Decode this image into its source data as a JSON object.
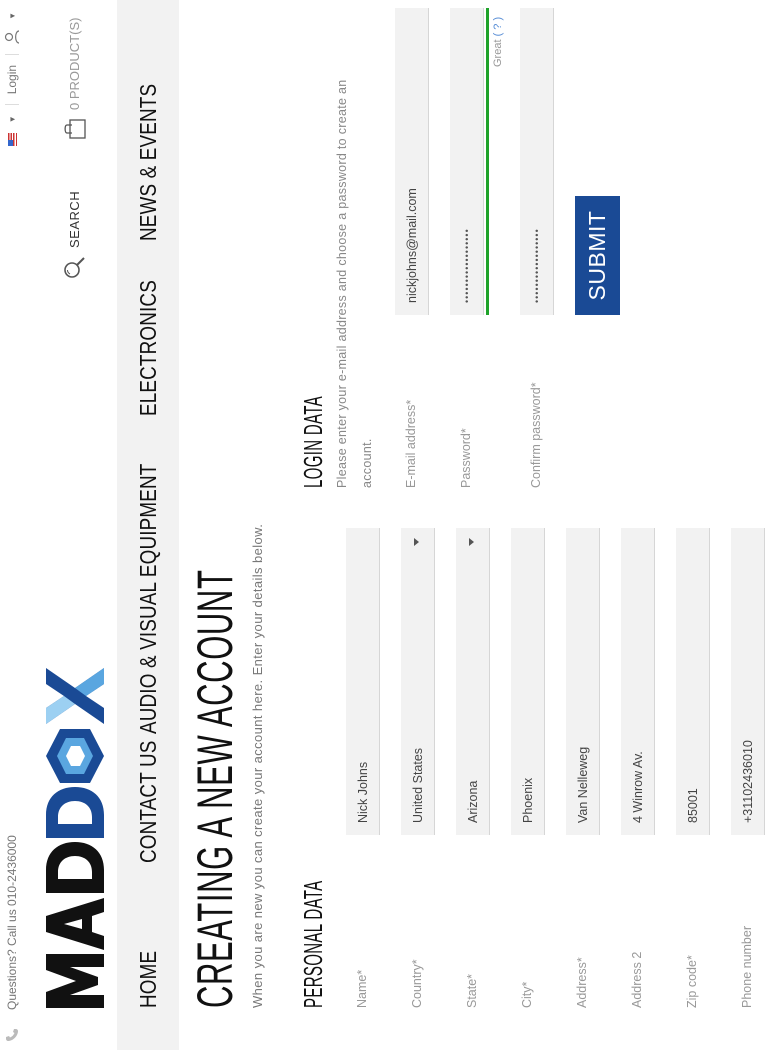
{
  "topbar": {
    "phone_text": "Questions? Call us 010-2436000",
    "login_label": "Login",
    "flag_icon": "us-flag-icon",
    "user_icon": "user-icon"
  },
  "header": {
    "logo_text": "MADDOX",
    "search_label": "SEARCH",
    "cart_label": "0 PRODUCT(S)"
  },
  "nav": {
    "items": [
      "HOME",
      "CONTACT US",
      "AUDIO & VISUAL EQUIPMENT",
      "ELECTRONICS",
      "NEWS & EVENTS"
    ]
  },
  "page": {
    "title": "CREATING A NEW ACCOUNT",
    "subtitle": "When you are new you can create your account here. Enter your details below."
  },
  "personal": {
    "heading": "PERSONAL DATA",
    "name_label": "Name*",
    "name_value": "Nick Johns",
    "country_label": "Country*",
    "country_value": "United States",
    "state_label": "State*",
    "state_value": "Arizona",
    "city_label": "City*",
    "city_value": "Phoenix",
    "address_label": "Address*",
    "address_value": "Van Nelleweg",
    "address2_label": "Address 2",
    "address2_value": "4 Winrow Av.",
    "zip_label": "Zip code*",
    "zip_value": "85001",
    "phone_label": "Phone number",
    "phone_value": "+3110243​6010"
  },
  "login": {
    "heading": "LOGIN DATA",
    "description_line1": "Please enter your e-mail address and choose a password to create an",
    "description_line2": "account.",
    "email_label": "E-mail address*",
    "email_value": "nickjohns@mail.com",
    "password_label": "Password*",
    "password_value": "••••••••••••••••••",
    "strength_text": "Great",
    "strength_help": "( ? )",
    "confirm_label": "Confirm password*",
    "confirm_value": "••••••••••••••••••",
    "submit_label": "SUBMIT"
  },
  "colors": {
    "accent": "#1a4a95",
    "strength": "#1fa32a",
    "field_bg": "#f2f2f2"
  }
}
